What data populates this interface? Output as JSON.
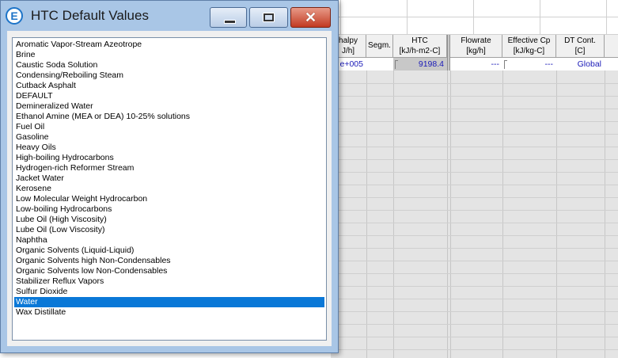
{
  "dialog": {
    "title": "HTC Default Values",
    "icon": "E",
    "buttons": {
      "minimize": "minimize-icon",
      "maximize": "maximize-icon",
      "close": "✕"
    },
    "items": [
      "Aromatic Vapor-Stream Azeotrope",
      "Brine",
      "Caustic Soda Solution",
      "Condensing/Reboiling Steam",
      "Cutback Asphalt",
      "DEFAULT",
      "Demineralized Water",
      "Ethanol Amine (MEA or DEA) 10-25% solutions",
      "Fuel Oil",
      "Gasoline",
      "Heavy Oils",
      "High-boiling Hydrocarbons",
      "Hydrogen-rich Reformer Stream",
      "Jacket Water",
      "Kerosene",
      "Low Molecular Weight Hydrocarbon",
      "Low-boiling Hydrocarbons",
      "Lube Oil (High Viscosity)",
      "Lube Oil (Low Viscosity)",
      "Naphtha",
      "Organic Solvents (Liquid-Liquid)",
      "Organic Solvents high Non-Condensables",
      "Organic Solvents low Non-Condensables",
      "Stabilizer Reflux Vapors",
      "Sulfur Dioxide",
      "Water",
      "Wax Distillate"
    ],
    "selected_item": "Water"
  },
  "grid": {
    "headers": {
      "enthalpy": {
        "line1": "halpy",
        "line2": "J/h]"
      },
      "segm": {
        "line1": "Segm.",
        "line2": ""
      },
      "htc": {
        "line1": "HTC",
        "line2": "[kJ/h-m2-C]"
      },
      "flowrate": {
        "line1": "Flowrate",
        "line2": "[kg/h]"
      },
      "effective_cp": {
        "line1": "Effective Cp",
        "line2": "[kJ/kg-C]"
      },
      "dt_cont": {
        "line1": "DT Cont.",
        "line2": "[C]"
      }
    },
    "row": {
      "enthalpy": "e+005",
      "htc": "9198.4",
      "flowrate": "---",
      "effective_cp": "---",
      "dt_cont": "Global"
    }
  },
  "colors": {
    "selection": "#0a78d7",
    "data_text": "#1a1ab8",
    "title_bar": "#a9c6e6"
  }
}
